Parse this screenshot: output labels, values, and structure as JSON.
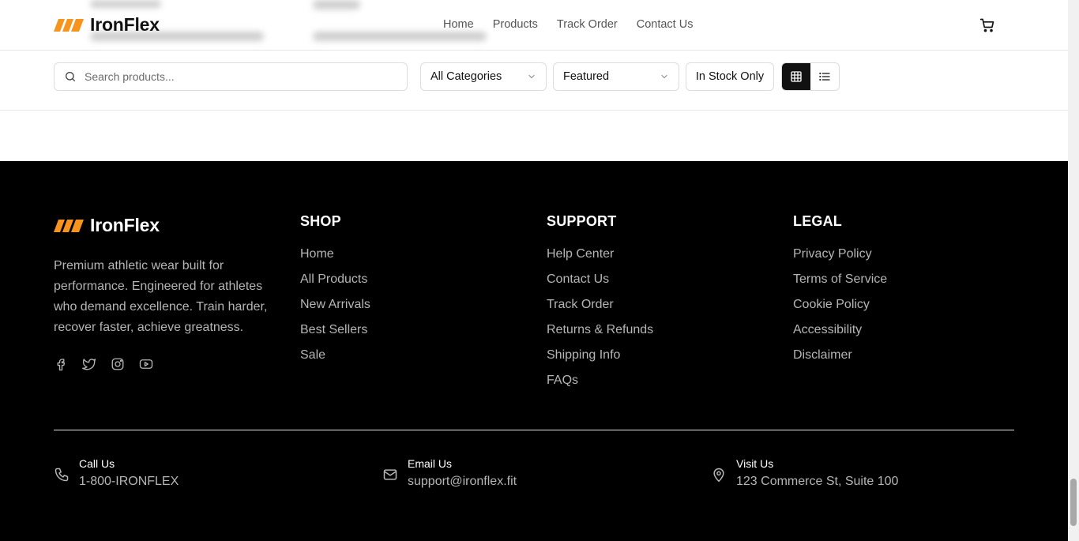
{
  "brand": {
    "name": "IronFlex",
    "accent": "#f7941d"
  },
  "nav": {
    "home": "Home",
    "products": "Products",
    "track_order": "Track Order",
    "contact": "Contact Us"
  },
  "filters": {
    "search_placeholder": "Search products...",
    "category": "All Categories",
    "sort": "Featured",
    "stock": "In Stock Only",
    "view_active": "grid"
  },
  "footer": {
    "description": "Premium athletic wear built for performance. Engineered for athletes who demand excellence. Train harder, recover faster, achieve greatness.",
    "socials": [
      "facebook-icon",
      "twitter-icon",
      "instagram-icon",
      "youtube-icon"
    ],
    "shop": {
      "title": "SHOP",
      "links": [
        "Home",
        "All Products",
        "New Arrivals",
        "Best Sellers",
        "Sale"
      ]
    },
    "support": {
      "title": "SUPPORT",
      "links": [
        "Help Center",
        "Contact Us",
        "Track Order",
        "Returns & Refunds",
        "Shipping Info",
        "FAQs"
      ]
    },
    "legal": {
      "title": "LEGAL",
      "links": [
        "Privacy Policy",
        "Terms of Service",
        "Cookie Policy",
        "Accessibility",
        "Disclaimer"
      ]
    },
    "contact": {
      "call_label": "Call Us",
      "call_value": "1-800-IRONFLEX",
      "email_label": "Email Us",
      "email_value": "support@ironflex.fit",
      "visit_label": "Visit Us",
      "visit_value": "123 Commerce St, Suite 100"
    }
  }
}
